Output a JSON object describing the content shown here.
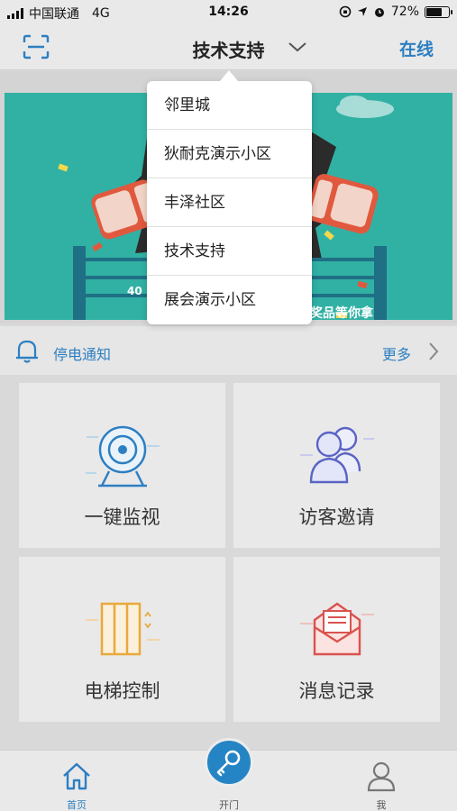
{
  "status_bar": {
    "carrier": "中国联通",
    "network": "4G",
    "time": "14:26",
    "battery": "72%",
    "battery_level": 0.72
  },
  "nav": {
    "title": "技术支持",
    "right_label": "在线",
    "accent_color": "#2d7fc2"
  },
  "banner": {
    "text_40": "40",
    "slogan": "奖品等你拿"
  },
  "dropdown": {
    "items": [
      "邻里城",
      "狄耐克演示小区",
      "丰泽社区",
      "技术支持",
      "展会演示小区"
    ]
  },
  "notice": {
    "label": "停电通知",
    "more": "更多"
  },
  "cards": [
    {
      "label": "一键监视",
      "icon": "camera-icon"
    },
    {
      "label": "访客邀请",
      "icon": "visitors-icon"
    },
    {
      "label": "电梯控制",
      "icon": "elevator-icon"
    },
    {
      "label": "消息记录",
      "icon": "envelope-icon"
    }
  ],
  "tabs": {
    "home": "首页",
    "open_door": "开门",
    "me": "我"
  },
  "colors": {
    "primary": "#2585c4",
    "banner_teal": "#31b1a4",
    "envelope_red": "#d9534f",
    "elevator_orange": "#e8a93c"
  }
}
